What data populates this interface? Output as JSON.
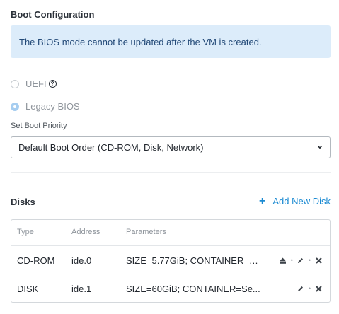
{
  "boot": {
    "title": "Boot Configuration",
    "info": "The BIOS mode cannot be updated after the VM is created.",
    "options": [
      {
        "label": "UEFI",
        "selected": false
      },
      {
        "label": "Legacy BIOS",
        "selected": true
      }
    ],
    "help_icon": "question-circle-icon",
    "priority_label": "Set Boot Priority",
    "priority_value": "Default Boot Order (CD-ROM, Disk, Network)"
  },
  "disks": {
    "title": "Disks",
    "add_label": "Add New Disk",
    "columns": [
      "Type",
      "Address",
      "Parameters"
    ],
    "rows": [
      {
        "type": "CD-ROM",
        "address": "ide.0",
        "parameters": "SIZE=5.77GiB; CONTAINER=S...",
        "actions": [
          "eject-icon",
          "edit-icon",
          "delete-icon"
        ]
      },
      {
        "type": "DISK",
        "address": "ide.1",
        "parameters": "SIZE=60GiB; CONTAINER=Se...",
        "actions": [
          "edit-icon",
          "delete-icon"
        ]
      }
    ]
  },
  "colors": {
    "accent": "#1b8ad2",
    "info_bg": "#dcecfa",
    "info_text": "#234a78",
    "radio_selected": "#a6cdf0"
  }
}
